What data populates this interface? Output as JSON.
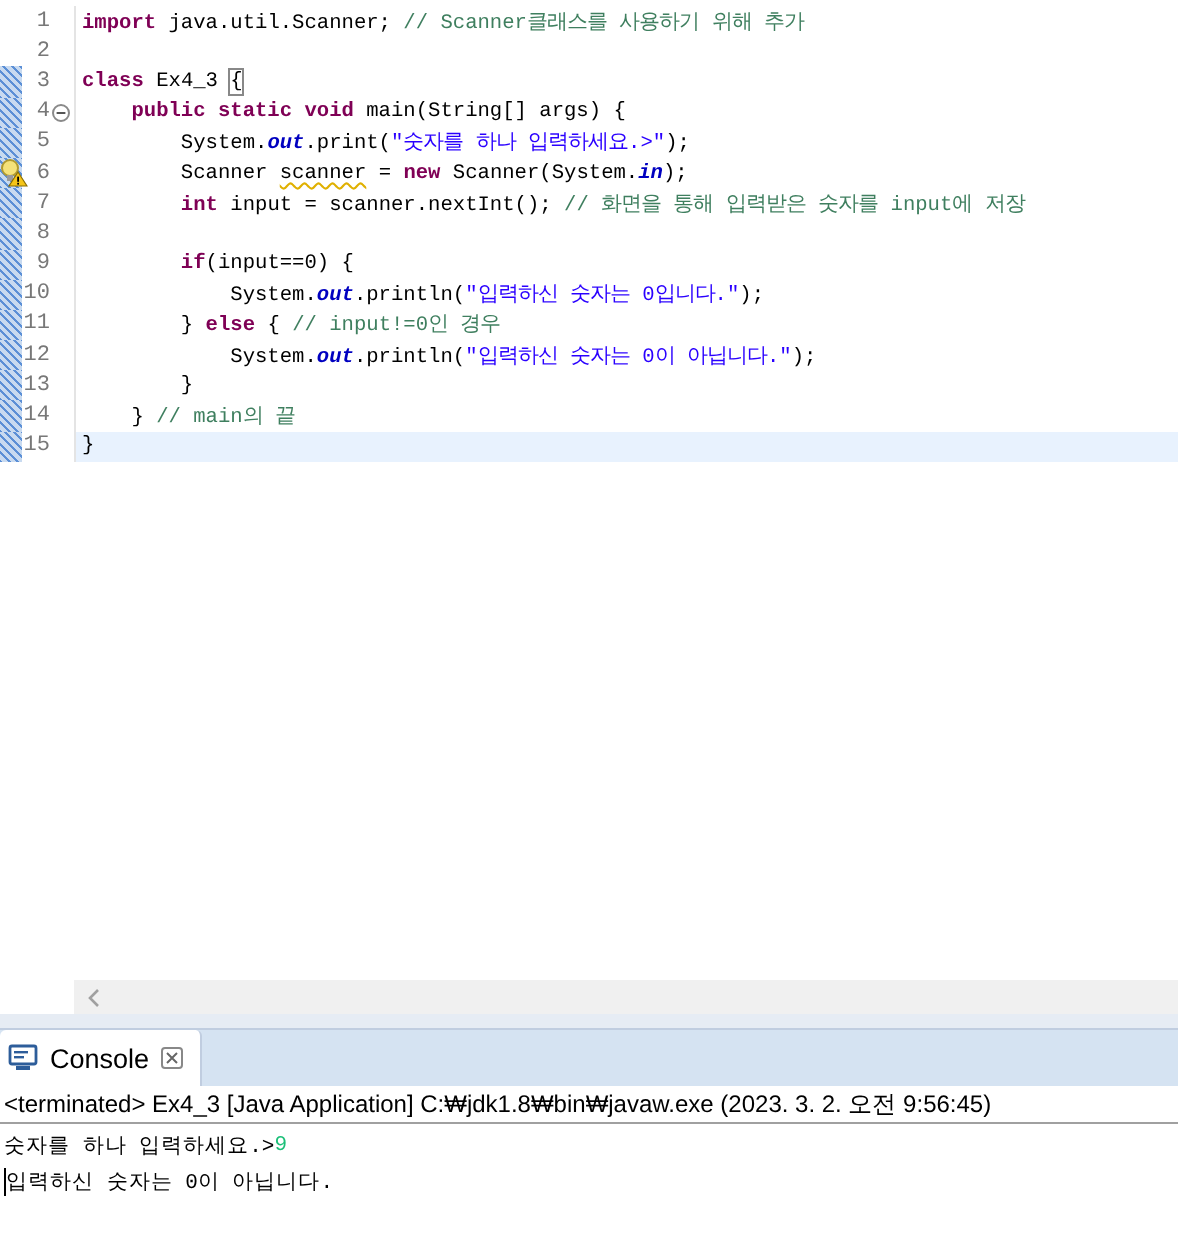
{
  "editor": {
    "lines": [
      {
        "number": "1",
        "changed": false,
        "current": false,
        "fold": false,
        "warning": false,
        "tokens": [
          {
            "kind": "kw",
            "text": "import"
          },
          {
            "kind": "text",
            "text": " java.util.Scanner; "
          },
          {
            "kind": "comment",
            "text": "// Scanner클래스를 사용하기 위해 추가"
          }
        ]
      },
      {
        "number": "2",
        "changed": false,
        "current": false,
        "fold": false,
        "warning": false
      },
      {
        "number": "3",
        "changed": true,
        "current": false,
        "fold": false,
        "warning": false,
        "tokens": [
          {
            "kind": "kw",
            "text": "class"
          },
          {
            "kind": "text",
            "text": " Ex4_3 "
          },
          {
            "kind": "bracket",
            "text": "{"
          }
        ]
      },
      {
        "number": "4",
        "changed": true,
        "current": false,
        "fold": true,
        "warning": false,
        "tokens": [
          {
            "kind": "kw",
            "text": "    public static void"
          },
          {
            "kind": "text",
            "text": " main(String[] args) {"
          }
        ]
      },
      {
        "number": "5",
        "changed": true,
        "current": false,
        "fold": false,
        "warning": false,
        "tokens": [
          {
            "kind": "text",
            "text": "        System."
          },
          {
            "kind": "field",
            "text": "out"
          },
          {
            "kind": "text",
            "text": ".print("
          },
          {
            "kind": "str",
            "text": "\"숫자를 하나 입력하세요.>\""
          },
          {
            "kind": "text",
            "text": ");"
          }
        ]
      },
      {
        "number": "6",
        "changed": true,
        "current": false,
        "fold": false,
        "warning": true,
        "tokens": [
          {
            "kind": "text",
            "text": "        Scanner "
          },
          {
            "kind": "squiggle",
            "text": "scanner"
          },
          {
            "kind": "text",
            "text": " = "
          },
          {
            "kind": "kw",
            "text": "new"
          },
          {
            "kind": "text",
            "text": " Scanner(System."
          },
          {
            "kind": "field",
            "text": "in"
          },
          {
            "kind": "text",
            "text": ");"
          }
        ]
      },
      {
        "number": "7",
        "changed": true,
        "current": false,
        "fold": false,
        "warning": false,
        "tokens": [
          {
            "kind": "kw",
            "text": "        int"
          },
          {
            "kind": "text",
            "text": " input = scanner.nextInt(); "
          },
          {
            "kind": "comment",
            "text": "// 화면을 통해 입력받은 숫자를 input에 저장"
          }
        ]
      },
      {
        "number": "8",
        "changed": true,
        "current": false,
        "fold": false,
        "warning": false
      },
      {
        "number": "9",
        "changed": true,
        "current": false,
        "fold": false,
        "warning": false,
        "tokens": [
          {
            "kind": "kw",
            "text": "        if"
          },
          {
            "kind": "text",
            "text": "(input==0) {"
          }
        ]
      },
      {
        "number": "10",
        "changed": true,
        "current": false,
        "fold": false,
        "warning": false,
        "tokens": [
          {
            "kind": "text",
            "text": "            System."
          },
          {
            "kind": "field",
            "text": "out"
          },
          {
            "kind": "text",
            "text": ".println("
          },
          {
            "kind": "str",
            "text": "\"입력하신 숫자는 0입니다.\""
          },
          {
            "kind": "text",
            "text": ");"
          }
        ]
      },
      {
        "number": "11",
        "changed": true,
        "current": false,
        "fold": false,
        "warning": false,
        "tokens": [
          {
            "kind": "text",
            "text": "        } "
          },
          {
            "kind": "kw",
            "text": "else"
          },
          {
            "kind": "text",
            "text": " { "
          },
          {
            "kind": "comment",
            "text": "// input!=0인 경우"
          }
        ]
      },
      {
        "number": "12",
        "changed": true,
        "current": false,
        "fold": false,
        "warning": false,
        "tokens": [
          {
            "kind": "text",
            "text": "            System."
          },
          {
            "kind": "field",
            "text": "out"
          },
          {
            "kind": "text",
            "text": ".println("
          },
          {
            "kind": "str",
            "text": "\"입력하신 숫자는 0이 아닙니다.\""
          },
          {
            "kind": "text",
            "text": ");"
          }
        ]
      },
      {
        "number": "13",
        "changed": true,
        "current": false,
        "fold": false,
        "warning": false,
        "tokens": [
          {
            "kind": "text",
            "text": "        }"
          }
        ]
      },
      {
        "number": "14",
        "changed": true,
        "current": false,
        "fold": false,
        "warning": false,
        "tokens": [
          {
            "kind": "text",
            "text": "    } "
          },
          {
            "kind": "comment",
            "text": "// main의 끝"
          }
        ]
      },
      {
        "number": "15",
        "changed": true,
        "current": true,
        "fold": false,
        "warning": false,
        "tokens": [
          {
            "kind": "text",
            "text": "}"
          }
        ]
      }
    ]
  },
  "console": {
    "tab": {
      "label": "Console",
      "selected": true
    },
    "header": "<terminated> Ex4_3 [Java Application] C:₩jdk1.8₩bin₩javaw.exe (2023. 3. 2. 오전 9:56:45)",
    "output": [
      {
        "kind": "prompt",
        "text": "숫자를 하나 입력하세요.>",
        "input": "9"
      },
      {
        "kind": "plain",
        "text": "입력하신 숫자는 0이 아닙니다."
      }
    ]
  }
}
